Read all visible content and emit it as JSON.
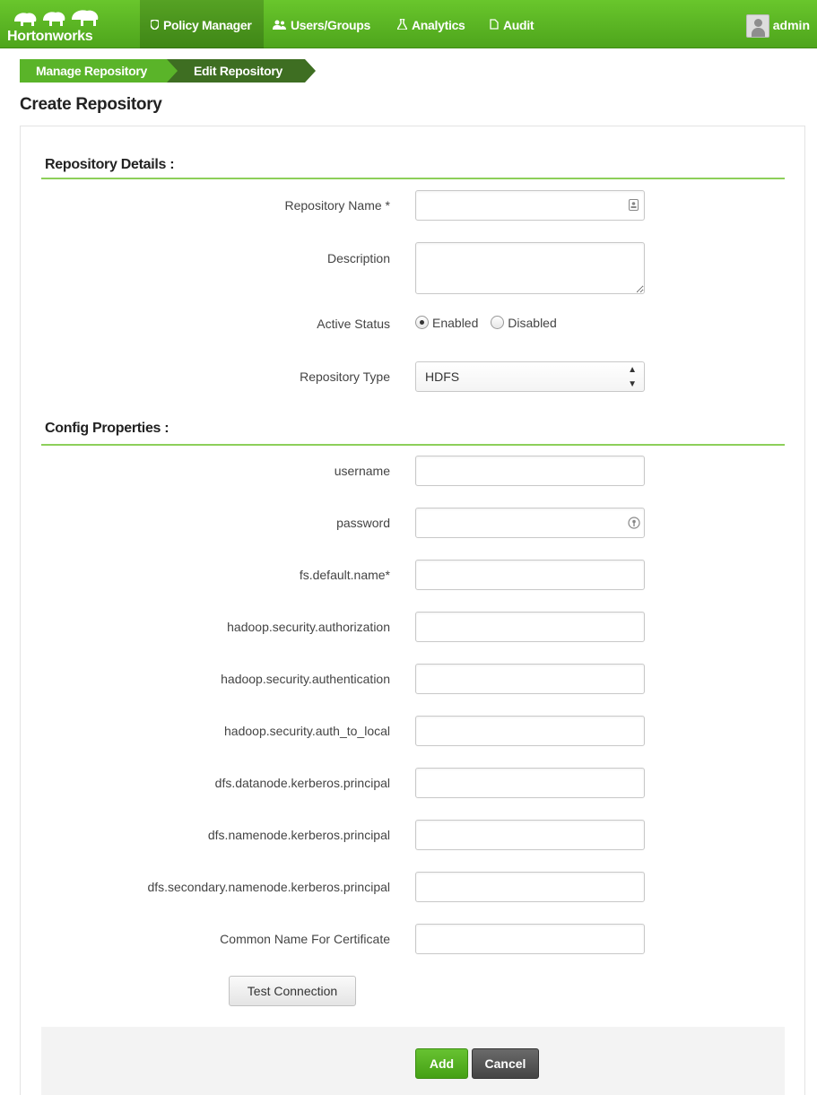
{
  "nav": {
    "brand": "Hortonworks",
    "items": [
      {
        "label": "Policy Manager",
        "icon": "shield-icon"
      },
      {
        "label": "Users/Groups",
        "icon": "users-icon"
      },
      {
        "label": "Analytics",
        "icon": "flask-icon"
      },
      {
        "label": "Audit",
        "icon": "file-icon"
      }
    ],
    "user": "admin"
  },
  "breadcrumb": [
    "Manage Repository",
    "Edit Repository"
  ],
  "page_title": "Create Repository",
  "repository_details": {
    "heading": "Repository Details :",
    "name_label": "Repository Name *",
    "name_value": "",
    "description_label": "Description",
    "description_value": "",
    "status_label": "Active Status",
    "status_options": [
      "Enabled",
      "Disabled"
    ],
    "status_selected": "Enabled",
    "type_label": "Repository Type",
    "type_value": "HDFS"
  },
  "config_properties": {
    "heading": "Config Properties :",
    "fields": [
      {
        "label": "username",
        "value": ""
      },
      {
        "label": "password",
        "value": ""
      },
      {
        "label": "fs.default.name*",
        "value": ""
      },
      {
        "label": "hadoop.security.authorization",
        "value": ""
      },
      {
        "label": "hadoop.security.authentication",
        "value": ""
      },
      {
        "label": "hadoop.security.auth_to_local",
        "value": ""
      },
      {
        "label": "dfs.datanode.kerberos.principal",
        "value": ""
      },
      {
        "label": "dfs.namenode.kerberos.principal",
        "value": ""
      },
      {
        "label": "dfs.secondary.namenode.kerberos.principal",
        "value": ""
      },
      {
        "label": "Common Name For Certificate",
        "value": ""
      }
    ]
  },
  "buttons": {
    "test_connection": "Test Connection",
    "add": "Add",
    "cancel": "Cancel"
  },
  "colors": {
    "brand_green": "#5ab429",
    "dark_crumb": "#3e6e22",
    "section_rule": "#8dcf5a"
  }
}
